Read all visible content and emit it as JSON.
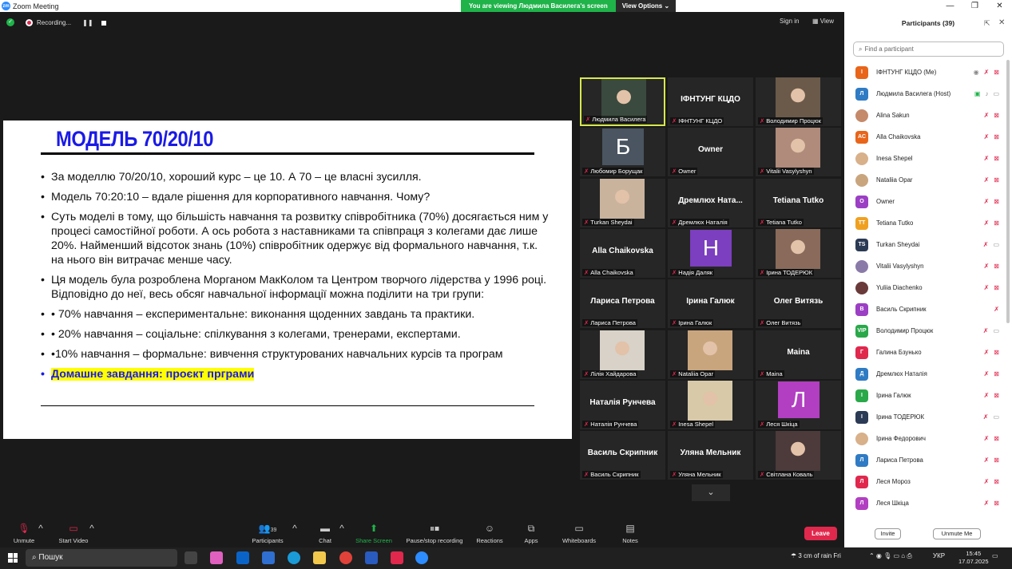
{
  "window": {
    "title": "Zoom Meeting",
    "app_icon": "zm",
    "controls": [
      "—",
      "❐",
      "✕"
    ]
  },
  "banner": {
    "message": "You are viewing Людмила Василега's screen",
    "view_options": "View Options ⌄"
  },
  "recording": {
    "label": "Recording...",
    "pause": "❚❚"
  },
  "top_right": {
    "sign_in": "Sign in",
    "view": "View"
  },
  "slide": {
    "title": "МОДЕЛЬ 70/20/10",
    "bullets": [
      "За моделлю 70/20/10, хороший курс – це 10. А 70 – це власні зусилля.",
      "Модель 70:20:10 – вдале рішення для корпоративного навчання. Чому?",
      "Суть моделі в тому, що більшість навчання та розвитку співробітника (70%) досягається ним у процесі самостійної роботи. А ось робота з наставниками та співпраця з колегами дає лише 20%. Найменший відсоток знань (10%) співробітник одержує від формального навчання, т.к. на нього він витрачає менше часу.",
      "Ця модель була розроблена Морганом МакКолом та Центром творчого лідерства у 1996 році. Відповідно до неї, весь обсяг навчальної інформації можна поділити на три групи:",
      "• 70% навчання – експериментальне: виконання щоденних завдань та практики.",
      "• 20% навчання – соціальне: спілкування з колегами, тренерами, експертами.",
      "•10% навчання – формальне: вивчення структурованих навчальних курсів та програм"
    ],
    "homework": "Домашне завдання: проєкт прграми"
  },
  "tiles": [
    {
      "name": "Людмила Василега",
      "type": "photo",
      "color": "#3a4a3e",
      "active": true
    },
    {
      "name": "ІФНТУНГ КЦДО",
      "type": "text",
      "big": "ІФНТУНГ КЦДО"
    },
    {
      "name": "Володимир Процюк",
      "type": "photo",
      "color": "#6b5a4a"
    },
    {
      "name": "Любомир Борущак",
      "type": "avatar",
      "letter": "Б",
      "color": "#4a5561"
    },
    {
      "name": "Owner",
      "type": "text",
      "big": "Owner"
    },
    {
      "name": "Vitalii Vasylyshyn",
      "type": "photo",
      "color": "#b08a7a"
    },
    {
      "name": "Turkan Sheydai",
      "type": "photo",
      "color": "#c9b39d"
    },
    {
      "name": "Дремлюх Наталія",
      "type": "text",
      "big": "Дремлюх  Ната..."
    },
    {
      "name": "Tetiana Tutko",
      "type": "text",
      "big": "Tetiana Tutko"
    },
    {
      "name": "Alla Chaikovska",
      "type": "text",
      "big": "Alla Chaikovska"
    },
    {
      "name": "Надія Даляк",
      "type": "avatar",
      "letter": "Н",
      "color": "#7b3fbf"
    },
    {
      "name": "Ірина ТОДЕРЮК",
      "type": "photo",
      "color": "#8a6a5a"
    },
    {
      "name": "Лариса Петрова",
      "type": "text",
      "big": "Лариса Петрова"
    },
    {
      "name": "Ірина Галюк",
      "type": "text",
      "big": "Ірина Галюк"
    },
    {
      "name": "Олег Витязь",
      "type": "text",
      "big": "Олег Витязь"
    },
    {
      "name": "Лілія Хайдарова",
      "type": "photo",
      "color": "#d8d2c8"
    },
    {
      "name": "Nataliia Opar",
      "type": "photo",
      "color": "#c9a57e"
    },
    {
      "name": "Maina",
      "type": "text",
      "big": "Maina"
    },
    {
      "name": "Наталія Рунчева",
      "type": "text",
      "big": "Наталія Рунчева"
    },
    {
      "name": "Inesa Shepel",
      "type": "photo",
      "color": "#d8c9a8"
    },
    {
      "name": "Леся Шкіца",
      "type": "avatar",
      "letter": "Л",
      "color": "#b23fc2"
    },
    {
      "name": "Василь Скрипник",
      "type": "text",
      "big": "Василь Скрипник"
    },
    {
      "name": "Уляна Мельник",
      "type": "text",
      "big": "Уляна Мельник"
    },
    {
      "name": "Світлана Коваль",
      "type": "photo",
      "color": "#4d3a3a"
    }
  ],
  "toolbar": {
    "unmute": "Unmute",
    "start_video": "Start Video",
    "participants": "Participants",
    "participants_count": "39",
    "chat": "Chat",
    "share": "Share Screen",
    "pause_rec": "Pause/stop recording",
    "reactions": "Reactions",
    "apps": "Apps",
    "whiteboards": "Whiteboards",
    "notes": "Notes",
    "leave": "Leave"
  },
  "panel": {
    "title": "Participants (39)",
    "search_placeholder": "Find a participant",
    "invite": "Invite",
    "unmute_me": "Unmute Me",
    "participants": [
      {
        "name": "ІФНТУНГ КЦДО (Me)",
        "initials": "І",
        "color": "#e8651a",
        "icons": "rec"
      },
      {
        "name": "Людмила Василега (Host)",
        "initials": "Л",
        "color": "#2f7bc4",
        "icons": "host"
      },
      {
        "name": "Alina Sakun",
        "initials": "",
        "color": "#c48a6a",
        "icons": "muted"
      },
      {
        "name": "Alla Chaikovska",
        "initials": "AC",
        "color": "#e8651a",
        "icons": "muted"
      },
      {
        "name": "Inesa Shepel",
        "initials": "",
        "color": "#d8b08a",
        "icons": "muted"
      },
      {
        "name": "Nataliia Opar",
        "initials": "",
        "color": "#c9a57e",
        "icons": "muted"
      },
      {
        "name": "Owner",
        "initials": "O",
        "color": "#9b3fc4",
        "icons": "muted"
      },
      {
        "name": "Tetiana Tutko",
        "initials": "TT",
        "color": "#f0a020",
        "icons": "muted"
      },
      {
        "name": "Turkan Sheydai",
        "initials": "TS",
        "color": "#2b3a55",
        "icons": "novideo"
      },
      {
        "name": "Vitalii Vasylyshyn",
        "initials": "",
        "color": "#8a7aa8",
        "icons": "muted"
      },
      {
        "name": "Yuliia Diachenko",
        "initials": "",
        "color": "#6a3a3a",
        "icons": "muted"
      },
      {
        "name": "Василь Скрипник",
        "initials": "В",
        "color": "#9b3fc4",
        "icons": "micoff"
      },
      {
        "name": "Володимир Процюк",
        "initials": "VIP",
        "color": "#2aa84a",
        "icons": "novideo"
      },
      {
        "name": "Галина Бзунько",
        "initials": "Г",
        "color": "#e0284d",
        "icons": "muted"
      },
      {
        "name": "Дремлюх Наталія",
        "initials": "Д",
        "color": "#2f7bc4",
        "icons": "muted"
      },
      {
        "name": "Ірина Галюк",
        "initials": "І",
        "color": "#2aa84a",
        "icons": "muted"
      },
      {
        "name": "Ірина ТОДЕРЮК",
        "initials": "І",
        "color": "#2b3a55",
        "icons": "novideo"
      },
      {
        "name": "Ірина Федорович",
        "initials": "",
        "color": "#d8b08a",
        "icons": "muted"
      },
      {
        "name": "Лариса Петрова",
        "initials": "Л",
        "color": "#2f7bc4",
        "icons": "muted"
      },
      {
        "name": "Леся Мороз",
        "initials": "Л",
        "color": "#e0284d",
        "icons": "muted"
      },
      {
        "name": "Леся Шкіца",
        "initials": "Л",
        "color": "#b23fc2",
        "icons": "muted"
      }
    ]
  },
  "taskbar": {
    "search": "Пошук",
    "weather": "3 cm of rain Fri",
    "lang": "УКР",
    "time": "15:45",
    "date": "17.07.2025"
  }
}
